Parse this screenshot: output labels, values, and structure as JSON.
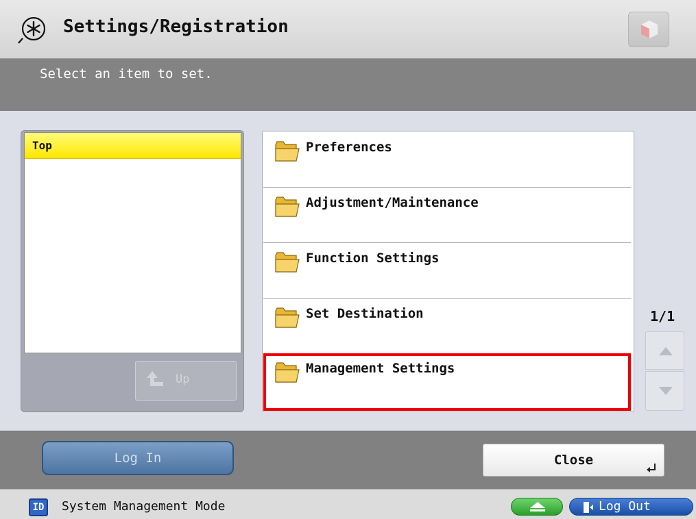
{
  "header": {
    "title": "Settings/Registration",
    "icon": "settings-asterisk-icon",
    "action_icon": "cube-icon"
  },
  "instruction": "Select an item to set.",
  "breadcrumb": {
    "items": [
      "Top"
    ],
    "up_label": "Up",
    "up_icon": "up-arrow-icon"
  },
  "menu": {
    "items": [
      {
        "label": "Preferences",
        "icon": "folder-icon"
      },
      {
        "label": "Adjustment/Maintenance",
        "icon": "folder-icon"
      },
      {
        "label": "Function Settings",
        "icon": "folder-icon"
      },
      {
        "label": "Set Destination",
        "icon": "folder-icon"
      },
      {
        "label": "Management Settings",
        "icon": "folder-icon",
        "highlighted": true
      }
    ],
    "highlight_color": "#ef0000"
  },
  "pager": {
    "counter": "1/1"
  },
  "actions": {
    "login_label": "Log In",
    "close_label": "Close"
  },
  "status": {
    "id_badge": "ID",
    "mode_text": "System Management Mode",
    "logout_label": "Log Out"
  },
  "colors": {
    "breadcrumb_active": "#ffe600",
    "login_button": "#4d74a2",
    "eject_button": "#2aa02a",
    "logout_button": "#184fa7"
  }
}
